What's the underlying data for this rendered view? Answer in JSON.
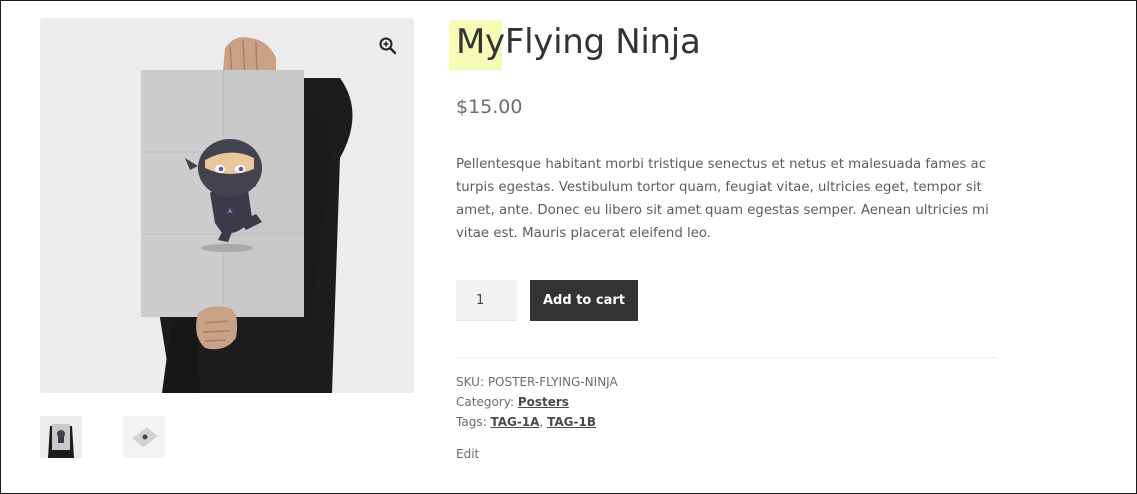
{
  "product": {
    "title_highlight": "My",
    "title_rest": "Flying Ninja",
    "price": "$15.00",
    "description": "Pellentesque habitant morbi tristique senectus et netus et malesuada fames ac turpis egestas. Vestibulum tortor quam, feugiat vitae, ultricies eget, tempor sit amet, ante. Donec eu libero sit amet quam egestas semper. Aenean ultricies mi vitae est. Mauris placerat eleifend leo.",
    "quantity": "1",
    "add_to_cart_label": "Add to cart",
    "sku_label": "SKU: ",
    "sku_value": "POSTER-FLYING-NINJA",
    "category_label": "Category: ",
    "category_value": "Posters",
    "tags_label": "Tags: ",
    "tags": [
      "TAG-1A",
      "TAG-1B"
    ],
    "tag_separator": ", ",
    "edit_label": "Edit"
  },
  "gallery": {
    "zoom_icon": "zoom-in-icon",
    "thumbnails": [
      "poster-held-thumbnail",
      "poster-flat-thumbnail"
    ]
  },
  "colors": {
    "highlight": "#f4fcb8",
    "button_bg": "#333333",
    "image_bg": "#ececec"
  }
}
